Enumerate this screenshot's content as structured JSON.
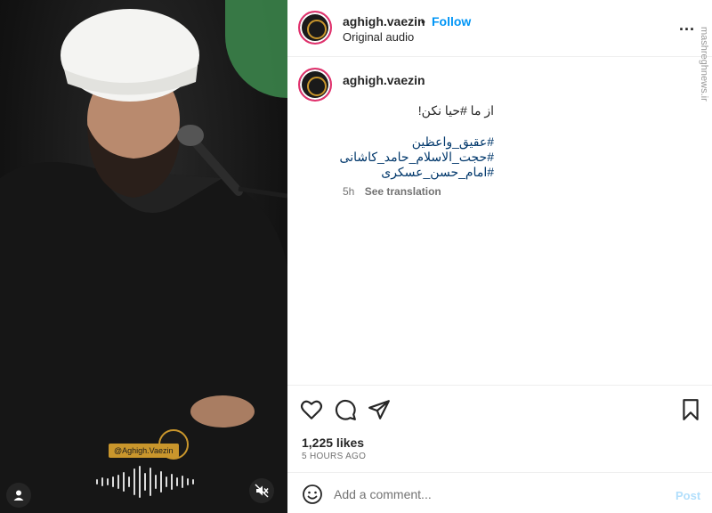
{
  "post": {
    "username": "aghigh.vaezin",
    "separator": "•",
    "follow_label": "Follow",
    "audio_label": "Original audio",
    "more_label": "...",
    "caption_username": "aghigh.vaezin",
    "caption_dot": ".",
    "caption_line": "از ما #حیا نکن!",
    "hashtags": [
      "#عقیق_واعظین",
      "#حجت_الاسلام_حامد_کاشانی",
      "#امام_حسن_عسکری"
    ],
    "time_ago": "5h",
    "see_translation": "See translation",
    "likes": "1,225 likes",
    "timestamp": "5 HOURS AGO"
  },
  "media": {
    "watermark_handle": "@Aghigh.Vaezin",
    "side_watermark": "mashreghnews.ir"
  },
  "comment": {
    "placeholder": "Add a comment...",
    "post_label": "Post"
  },
  "colors": {
    "accent": "#0095f6",
    "post_disabled": "#b2dffc",
    "gold": "#c9962c"
  },
  "icons": [
    "heart-icon",
    "comment-icon",
    "share-icon",
    "bookmark-icon",
    "emoji-icon",
    "user-icon",
    "mute-icon",
    "more-icon"
  ]
}
